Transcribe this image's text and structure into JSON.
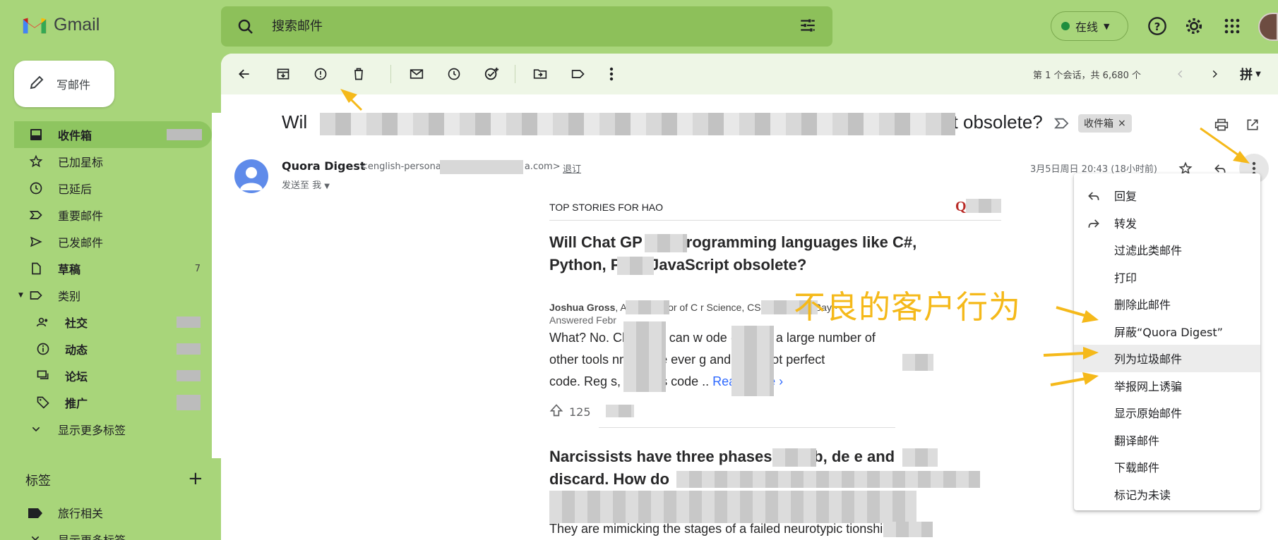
{
  "app": {
    "brand": "Gmail"
  },
  "search": {
    "placeholder": "搜索邮件"
  },
  "status": {
    "label": "在线"
  },
  "compose": {
    "label": "写邮件"
  },
  "nav": [
    {
      "id": "inbox",
      "label": "收件箱",
      "icon": "inbox-icon",
      "count": "",
      "active": true
    },
    {
      "id": "starred",
      "label": "已加星标",
      "icon": "star-icon"
    },
    {
      "id": "snoozed",
      "label": "已延后",
      "icon": "clock-icon"
    },
    {
      "id": "important",
      "label": "重要邮件",
      "icon": "important-icon"
    },
    {
      "id": "sent",
      "label": "已发邮件",
      "icon": "send-icon"
    },
    {
      "id": "drafts",
      "label": "草稿",
      "icon": "draft-icon",
      "count": "7",
      "bold": true
    },
    {
      "id": "categories",
      "label": "类别",
      "icon": "label-icon"
    },
    {
      "id": "social",
      "label": "社交",
      "icon": "people-icon",
      "sub": true
    },
    {
      "id": "updates",
      "label": "动态",
      "icon": "info-icon",
      "sub": true
    },
    {
      "id": "forums",
      "label": "论坛",
      "icon": "forum-icon",
      "sub": true
    },
    {
      "id": "promotions",
      "label": "推广",
      "icon": "tag-icon",
      "sub": true
    },
    {
      "id": "more",
      "label": "显示更多标签",
      "icon": "chevron-down-icon"
    }
  ],
  "labels": {
    "heading": "标签",
    "items": [
      {
        "label": "旅行相关"
      },
      {
        "label": "显示更多标签"
      }
    ]
  },
  "toolbar": {
    "page_info": "第 1 个会话，共 6,680 个",
    "input_tool": "拼"
  },
  "email": {
    "subject_start": "Wil",
    "subject_end": "ot obsolete?",
    "inbox_chip": "收件箱",
    "chip_close": "×",
    "sender": "Quora Digest",
    "sender_email_start": "<english-persona",
    "sender_email_end": "a.com>",
    "unsubscribe": "退订",
    "to_me": "发送至 我",
    "date": "3月5日周日 20:43 (18小时前)"
  },
  "digest": {
    "top_stories": "TOP STORIES FOR HAO",
    "logo_letter": "Q",
    "story1_line1": "Will Chat GP       ake programming languages like C#,",
    "story1_line2": "Python, PH       d JavaScript obsolete?",
    "author_name": "Joshua Gross",
    "author_rest": ", A          t Professor of C            r Science, CSU Monterey Bay ·",
    "answered": "Answered Febr",
    "excerpt_1": "What? No.        ChatGPT can w       ode (as can a large number of",
    "excerpt_2": "other tools        nnot write ever          g and it cannot       perfect",
    "excerpt_3": "code. Reg         s, it writes code          .. ",
    "read_more": "Read more ›",
    "upvotes": "125",
    "story2_line1": "Narcissists have three phases,          bomb, de         e and",
    "story2_line2": "discard. How do",
    "last_line": "They are mimicking the stages of a failed neurotypic          tionship."
  },
  "menu": {
    "items": [
      {
        "label": "回复",
        "icon": "reply-icon"
      },
      {
        "label": "转发",
        "icon": "forward-icon"
      },
      {
        "label": "过滤此类邮件"
      },
      {
        "label": "打印"
      },
      {
        "label": "删除此邮件"
      },
      {
        "label": "屏蔽“Quora Digest”"
      },
      {
        "label": "列为垃圾邮件",
        "highlighted": true
      },
      {
        "label": "举报网上诱骗"
      },
      {
        "label": "显示原始邮件"
      },
      {
        "label": "翻译邮件"
      },
      {
        "label": "下载邮件"
      },
      {
        "label": "标记为未读"
      }
    ]
  },
  "annotation": {
    "text": "不良的客户行为",
    "color": "#f5b91a"
  },
  "colors": {
    "theme_green": "#a8d57a",
    "search_bg": "#8dc05a",
    "active_nav": "#8ec560"
  }
}
